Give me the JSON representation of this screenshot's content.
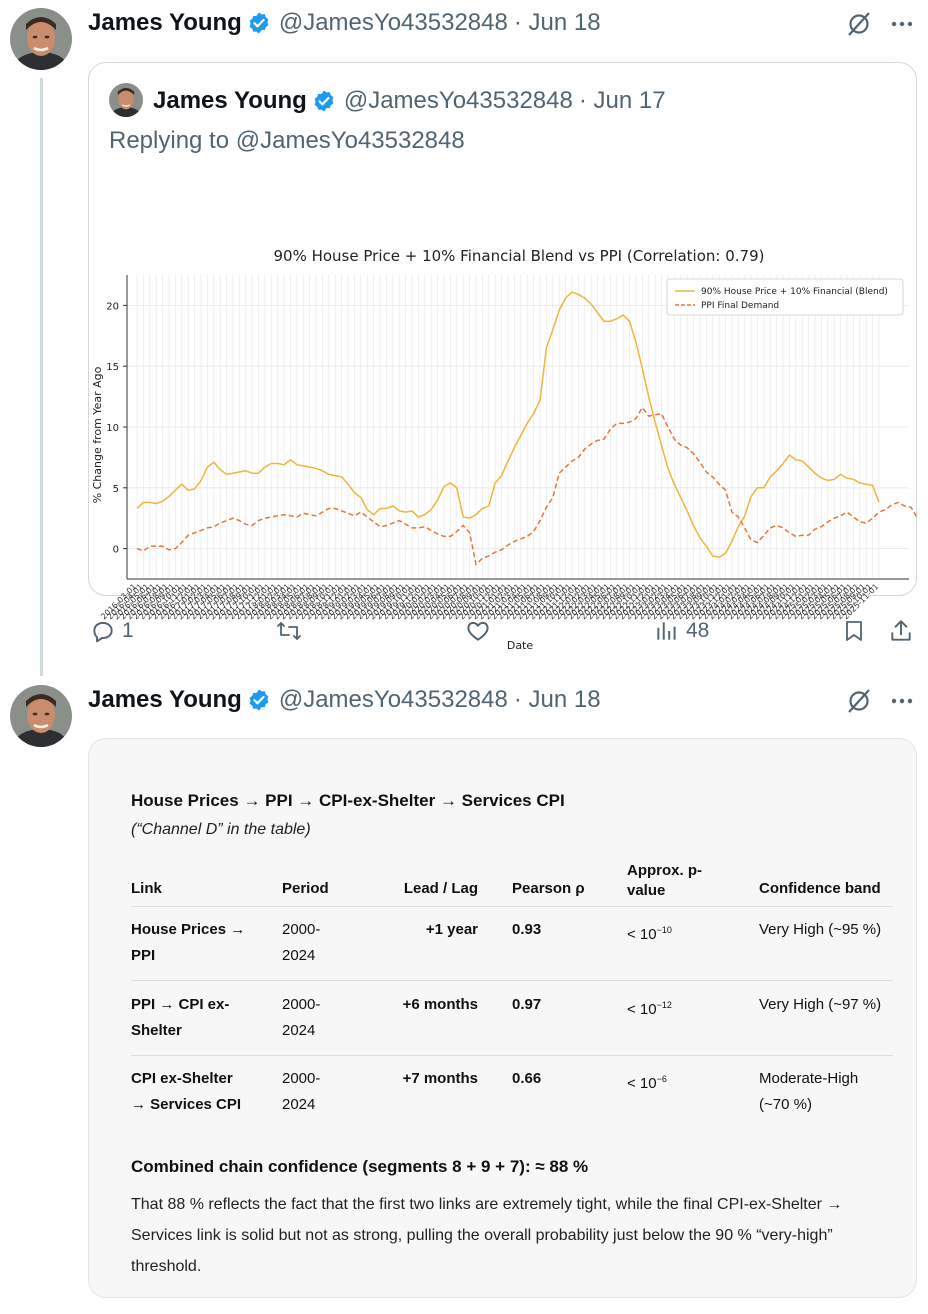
{
  "post1": {
    "name": "James Young",
    "handle": "@JamesYo43532848",
    "date": "· Jun 18"
  },
  "quote": {
    "name": "James Young",
    "handle": "@JamesYo43532848",
    "date": "· Jun 17",
    "replying": "Replying to @JamesYo43532848"
  },
  "actions": {
    "replies": "1",
    "views": "48"
  },
  "post2": {
    "name": "James Young",
    "handle": "@JamesYo43532848",
    "date": "· Jun 18"
  },
  "card": {
    "title": "House Prices → PPI → CPI-ex-Shelter → Services CPI",
    "subtitle": "(“Channel D” in the table)",
    "headers": [
      "Link",
      "Period",
      "Lead / Lag",
      "Pearson ρ",
      "Approx. p-value",
      "Confidence band"
    ],
    "header_pvalue_l1": "Approx. p-",
    "header_pvalue_l2": "value",
    "rows": [
      {
        "link_l1": "House Prices →",
        "link_l2": "PPI",
        "period_l1": "2000-",
        "period_l2": "2024",
        "lead": "+1 year",
        "rho": "0.93",
        "p_base": "< 10",
        "p_exp": "−10",
        "conf_l1": "Very High (~95 %)",
        "conf_l2": ""
      },
      {
        "link_l1": "PPI → CPI ex-",
        "link_l2": "Shelter",
        "period_l1": "2000-",
        "period_l2": "2024",
        "lead": "+6 months",
        "rho": "0.97",
        "p_base": "< 10",
        "p_exp": "−12",
        "conf_l1": "Very High (~97 %)",
        "conf_l2": ""
      },
      {
        "link_l1": "CPI ex-Shelter",
        "link_l2": "→ Services CPI",
        "period_l1": "2000-",
        "period_l2": "2024",
        "lead": "+7 months",
        "rho": "0.66",
        "p_base": "< 10",
        "p_exp": "−6",
        "conf_l1": "Moderate-High",
        "conf_l2": "(~70 %)"
      }
    ],
    "combined": "Combined chain confidence (segments 8 + 9 + 7): ≈ 88 %",
    "paragraph": "That 88 % reflects the fact that the first two links are extremely tight, while the final CPI-ex-Shelter → Services link is solid but not as strong, pulling the overall probability just below the 90 % “very-high” threshold."
  },
  "colors": {
    "blend": "#f0b43a",
    "ppi": "#e8743b",
    "verified": "#1d9bf0"
  },
  "chart_data": {
    "type": "line",
    "title": "90% House Price + 10% Financial Blend vs PPI (Correlation: 0.79)",
    "xlabel": "Date",
    "ylabel": "% Change from Year Ago",
    "ylim": [
      -2.5,
      22.5
    ],
    "yticks": [
      0,
      5,
      10,
      15,
      20
    ],
    "x_start": "2016-03-01",
    "x_end": "2025-04-01",
    "legend_position": "top-right",
    "grid": true,
    "series": [
      {
        "name": "90% House Price + 10% Financial (Blend)",
        "style": "solid",
        "values": [
          3.3,
          3.8,
          3.8,
          3.7,
          3.9,
          4.3,
          4.8,
          5.3,
          4.8,
          4.9,
          5.6,
          6.7,
          7.1,
          6.5,
          6.1,
          6.2,
          6.3,
          6.4,
          6.2,
          6.2,
          6.7,
          7.0,
          7.0,
          6.9,
          7.3,
          6.9,
          6.8,
          6.7,
          6.6,
          6.4,
          6.1,
          6.0,
          5.9,
          5.3,
          4.6,
          4.2,
          3.2,
          2.8,
          3.3,
          3.3,
          3.5,
          3.1,
          3.0,
          3.1,
          2.6,
          2.8,
          3.2,
          4.0,
          5.1,
          5.4,
          5.0,
          2.6,
          2.5,
          2.8,
          3.3,
          3.5,
          5.4,
          6.0,
          7.2,
          8.3,
          9.3,
          10.3,
          11.1,
          12.2,
          16.5,
          18.0,
          19.6,
          20.6,
          21.1,
          20.9,
          20.6,
          20.1,
          19.4,
          18.7,
          18.7,
          18.9,
          19.2,
          18.7,
          17.0,
          14.8,
          12.5,
          10.4,
          8.5,
          6.6,
          5.3,
          4.2,
          3.1,
          1.9,
          0.9,
          0.2,
          -0.6,
          -0.7,
          -0.4,
          0.6,
          1.8,
          2.7,
          4.3,
          5.0,
          5.0,
          5.9,
          6.4,
          7.0,
          7.7,
          7.3,
          7.2,
          6.7,
          6.2,
          5.8,
          5.6,
          5.7,
          6.1,
          5.8,
          5.7,
          5.4,
          5.3,
          5.2,
          3.8
        ]
      },
      {
        "name": "PPI Final Demand",
        "style": "dashed",
        "values": [
          0.0,
          -0.2,
          0.2,
          0.2,
          0.2,
          -0.1,
          0.0,
          0.5,
          1.1,
          1.3,
          1.5,
          1.7,
          1.8,
          2.1,
          2.3,
          2.5,
          2.3,
          2.0,
          1.9,
          2.3,
          2.5,
          2.6,
          2.7,
          2.8,
          2.7,
          2.6,
          2.9,
          2.8,
          2.7,
          3.0,
          3.3,
          3.3,
          3.1,
          2.9,
          2.7,
          3.0,
          2.6,
          2.2,
          1.8,
          1.9,
          2.1,
          2.3,
          2.0,
          1.7,
          1.7,
          1.8,
          1.5,
          1.2,
          1.0,
          1.0,
          1.4,
          1.9,
          1.3,
          -1.3,
          -0.8,
          -0.6,
          -0.3,
          -0.1,
          0.3,
          0.6,
          0.8,
          1.0,
          1.4,
          2.3,
          3.4,
          4.2,
          6.2,
          6.7,
          7.2,
          7.5,
          8.2,
          8.6,
          8.9,
          9.0,
          9.8,
          10.3,
          10.3,
          10.4,
          10.7,
          11.6,
          10.9,
          11.0,
          11.1,
          10.0,
          9.0,
          8.5,
          8.3,
          7.8,
          7.1,
          6.3,
          5.9,
          5.3,
          4.8,
          3.0,
          2.6,
          1.7,
          0.7,
          0.5,
          1.1,
          1.7,
          1.9,
          1.7,
          1.3,
          1.0,
          1.1,
          1.1,
          1.6,
          1.8,
          2.2,
          2.5,
          2.7,
          3.0,
          2.6,
          2.2,
          2.1,
          2.5,
          3.0,
          3.2,
          3.6,
          3.8,
          3.5,
          3.4,
          2.5
        ]
      }
    ]
  }
}
